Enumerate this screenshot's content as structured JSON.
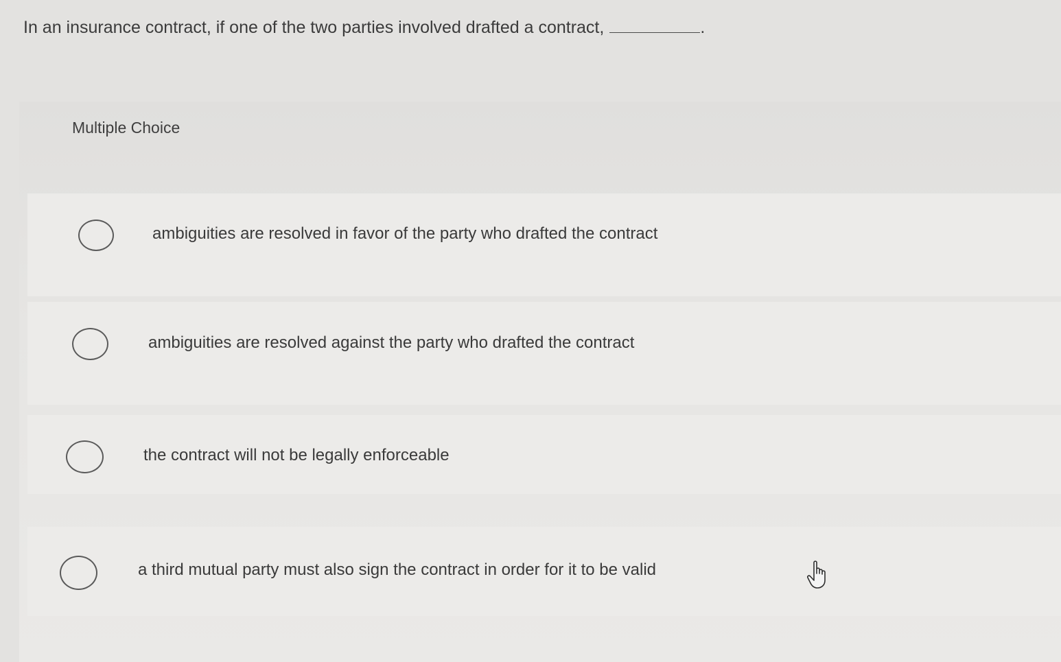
{
  "question": {
    "text": "In an insurance contract, if one of the two parties involved drafted a contract,",
    "trailing": "."
  },
  "section_label": "Multiple Choice",
  "options": [
    {
      "label": "ambiguities are resolved in favor of the party who drafted the contract",
      "selected": false
    },
    {
      "label": "ambiguities are resolved against the party who drafted the contract",
      "selected": false
    },
    {
      "label": "the contract will not be legally enforceable",
      "selected": false
    },
    {
      "label": "a third mutual party must also sign the contract in order for it to be valid",
      "selected": false
    }
  ],
  "icons": {
    "radio": "radio-button-empty",
    "cursor": "hand-pointer-cursor"
  },
  "colors": {
    "background": "#e3e2e0",
    "text": "#3a3a3a",
    "radio_border": "#5a5a5a"
  }
}
